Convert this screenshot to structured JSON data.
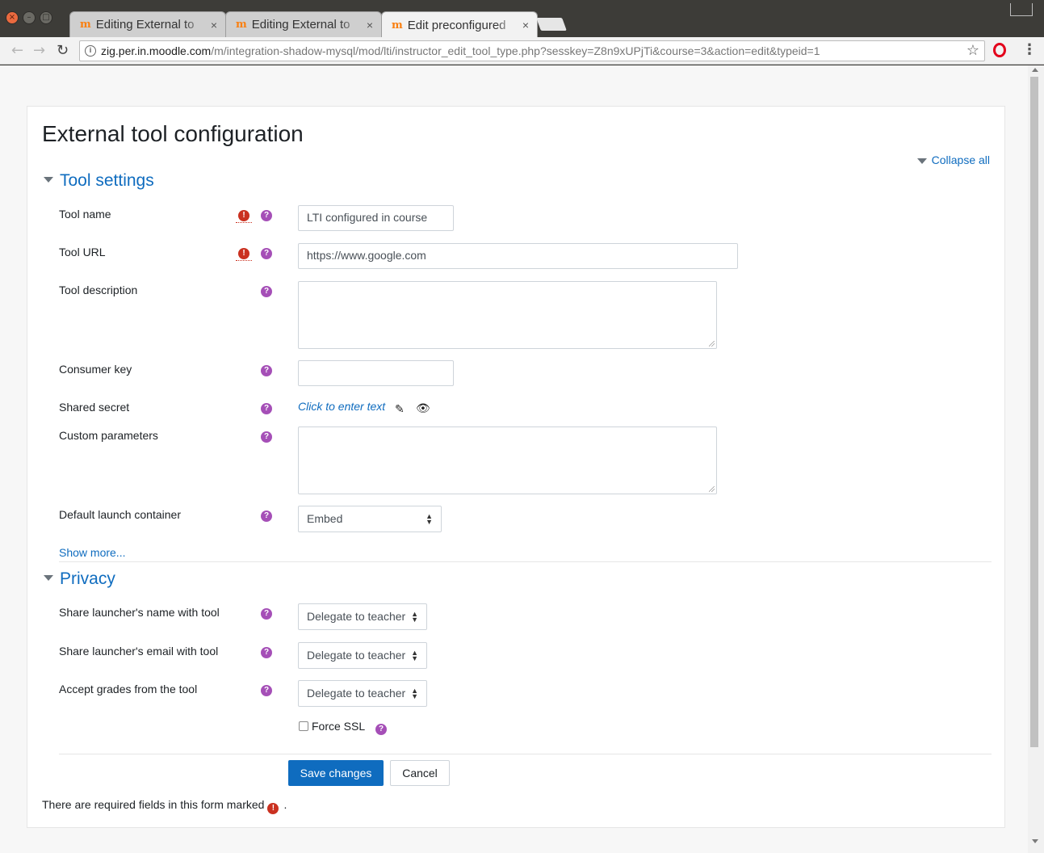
{
  "browser": {
    "tabs": [
      {
        "label": "Editing External to",
        "close": "×"
      },
      {
        "label": "Editing External to",
        "close": "×"
      },
      {
        "label": "Edit preconfigured",
        "close": "×"
      }
    ],
    "tab_favicon": "m",
    "url_host": "zig.per.in.moodle.com",
    "url_path": "/m/integration-shadow-mysql/mod/lti/instructor_edit_tool_type.php?sesskey=Z8n9xUPjTi&course=3&action=edit&typeid=1",
    "icons": {
      "back": "back-arrow-icon",
      "forward": "forward-arrow-icon",
      "reload": "reload-icon",
      "info": "info-icon",
      "star": "star-icon",
      "opera": "opera-icon",
      "menu": "kebab-menu-icon"
    }
  },
  "page": {
    "title": "External tool configuration",
    "collapse_all": "Collapse all",
    "sections": {
      "tool_settings": "Tool settings",
      "privacy": "Privacy"
    },
    "fields": {
      "tool_name": {
        "label": "Tool name",
        "value": "LTI configured in course"
      },
      "tool_url": {
        "label": "Tool URL",
        "value": "https://www.google.com"
      },
      "tool_description": {
        "label": "Tool description",
        "value": ""
      },
      "consumer_key": {
        "label": "Consumer key",
        "value": ""
      },
      "shared_secret": {
        "label": "Shared secret",
        "value": "Click to enter text"
      },
      "custom_parameters": {
        "label": "Custom parameters",
        "value": ""
      },
      "default_launch_container": {
        "label": "Default launch container",
        "value": "Embed"
      }
    },
    "show_more": "Show more...",
    "privacy": {
      "share_name": {
        "label": "Share launcher's name with tool",
        "value": "Delegate to teacher"
      },
      "share_email": {
        "label": "Share launcher's email with tool",
        "value": "Delegate to teacher"
      },
      "accept_grades": {
        "label": "Accept grades from the tool",
        "value": "Delegate to teacher"
      },
      "force_ssl": {
        "label": "Force SSL",
        "checked": false
      }
    },
    "buttons": {
      "save": "Save changes",
      "cancel": "Cancel"
    },
    "required_note": "There are required fields in this form marked",
    "required_note_end": ".",
    "icon_glyphs": {
      "required": "!",
      "help": "?"
    }
  },
  "colors": {
    "link": "#0f6cbf",
    "primary_button": "#0f6cbf",
    "required_icon": "#ca3120",
    "help_icon": "#a54fb7"
  }
}
